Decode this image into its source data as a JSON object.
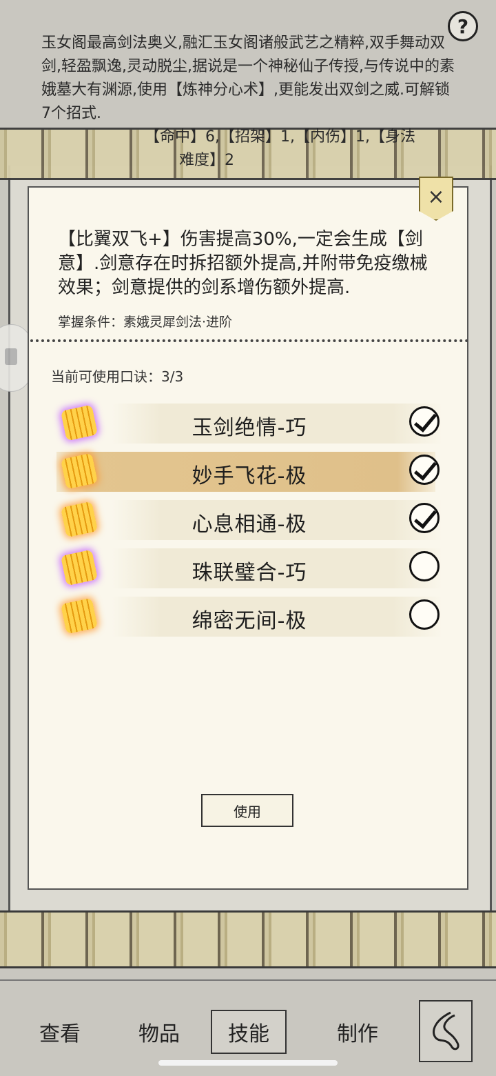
{
  "background": {
    "description": "玉女阁最高剑法奥义,融汇玉女阁诸般武艺之精粹,双手舞动双剑,轻盈飘逸,灵动脱尘,据说是一个神秘仙子传授,与传说中的素娥墓大有渊源,使用【炼神分心术】,更能发出双剑之威.可解锁7个招式.",
    "stats_line": "【命中】6,【招架】1,【内伤】1,【身法",
    "difficulty_line": "难度】2",
    "help_label": "?"
  },
  "dialog": {
    "close_label": "×",
    "effect_text": "【比翼双飞+】伤害提高30%,一定会生成【剑意】.剑意存在时拆招额外提高,并附带免疫缴械效果；剑意提供的剑系增伤额外提高.",
    "mastery_label": "掌握条件：素娥灵犀剑法·进阶",
    "koujue_count": "当前可使用口诀：3/3",
    "skills": [
      {
        "name": "玉剑绝情-巧",
        "checked": true,
        "icon": "purple-scroll-icon"
      },
      {
        "name": "妙手飞花-极",
        "checked": true,
        "icon": "gold-scroll-icon",
        "selected": true
      },
      {
        "name": "心息相通-极",
        "checked": true,
        "icon": "gold-scroll-icon"
      },
      {
        "name": "珠联璧合-巧",
        "checked": false,
        "icon": "purple-scroll-icon"
      },
      {
        "name": "绵密无间-极",
        "checked": false,
        "icon": "gold-scroll-icon"
      }
    ],
    "use_label": "使用"
  },
  "nav": {
    "tabs": [
      "查看",
      "物品",
      "技能",
      "制作"
    ],
    "active": "技能",
    "back_icon": "back-arrow-icon"
  },
  "colors": {
    "dialog_bg": "#faf7ec",
    "selected_row": "#dfc08a",
    "gold_icon": "#f5b522",
    "purple_glow": "#be50ff"
  }
}
